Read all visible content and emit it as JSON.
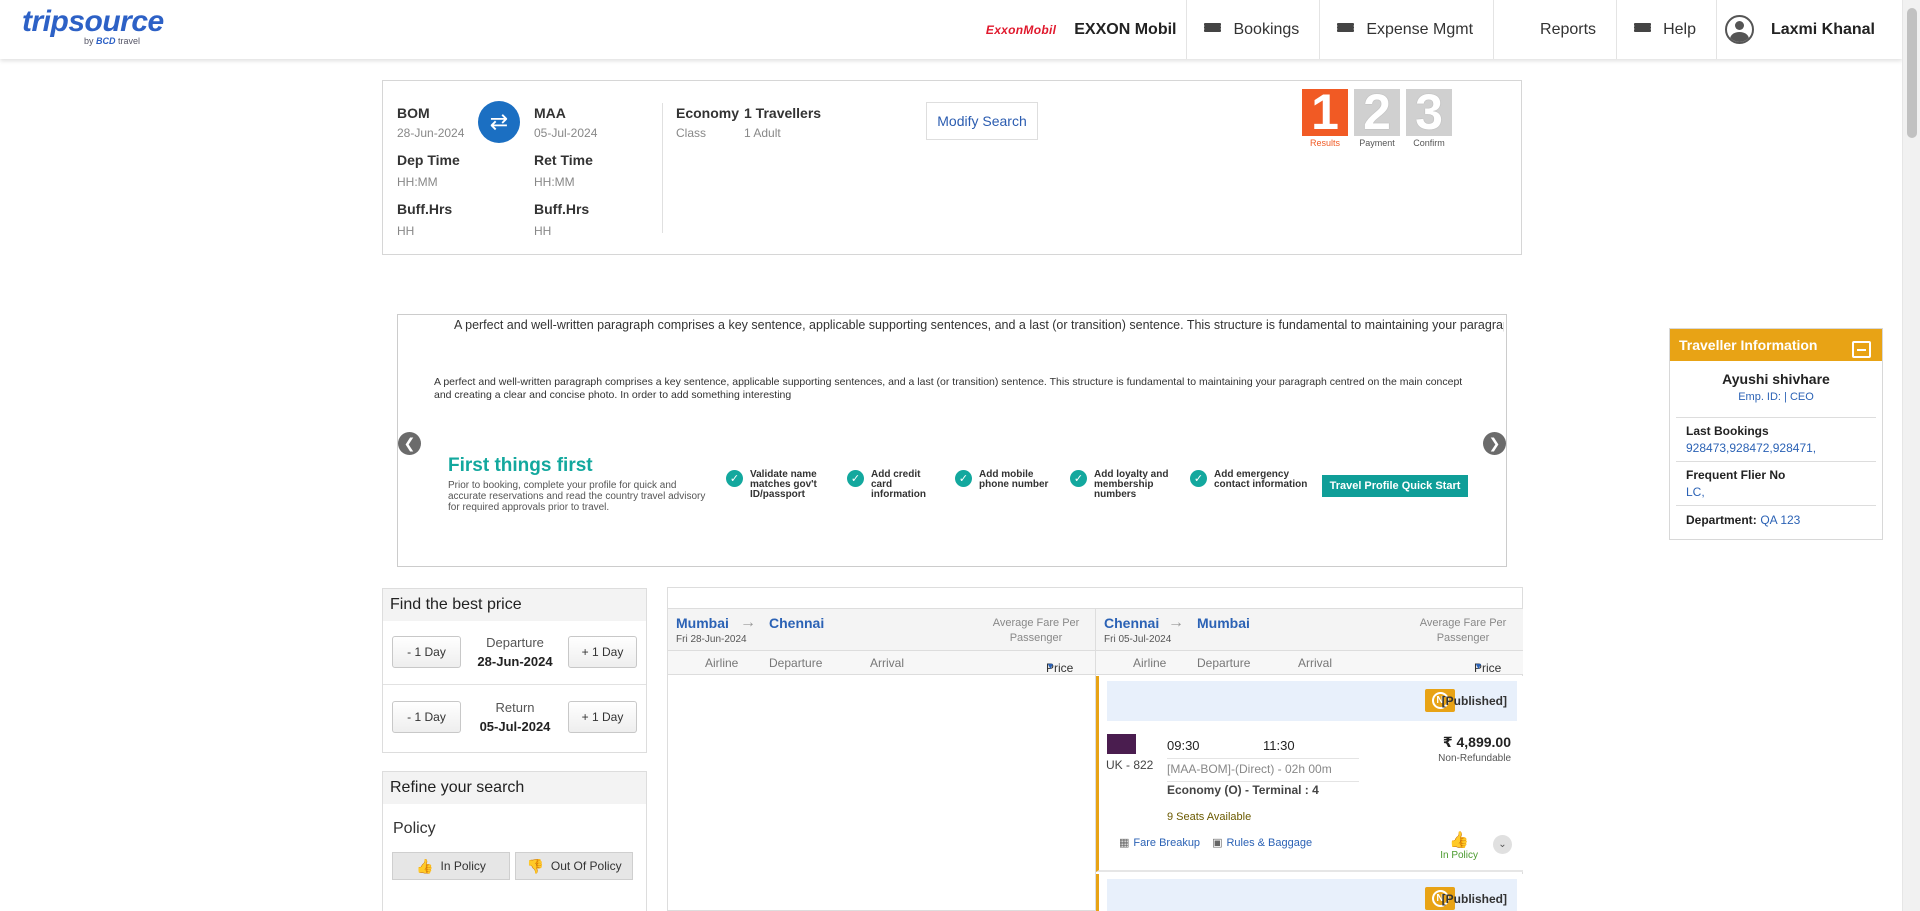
{
  "header": {
    "logo_main": "tripsource",
    "logo_sub_prefix": "by",
    "logo_sub_brand": "BCD",
    "logo_sub_suffix": "travel",
    "company_logo_text": "ExxonMobil",
    "company_name": "EXXON Mobil",
    "nav": [
      {
        "label": "Bookings",
        "icon": "menu-icon"
      },
      {
        "label": "Expense Mgmt",
        "icon": "menu-icon"
      },
      {
        "label": "Reports",
        "icon": "bar-chart-icon"
      },
      {
        "label": "Help",
        "icon": "menu-icon"
      }
    ],
    "user_name": "Laxmi Khanal"
  },
  "search_summary": {
    "origin": {
      "code": "BOM",
      "date": "28-Jun-2024",
      "time_label": "Dep Time",
      "time_hint": "HH:MM",
      "buffer_label": "Buff.Hrs",
      "buffer_hint": "HH"
    },
    "destination": {
      "code": "MAA",
      "date": "05-Jul-2024",
      "time_label": "Ret Time",
      "time_hint": "HH:MM",
      "buffer_label": "Buff.Hrs",
      "buffer_hint": "HH"
    },
    "cabin": {
      "value": "Economy",
      "label": "Class"
    },
    "travellers": {
      "value": "1 Travellers",
      "label": "1 Adult"
    },
    "modify_label": "Modify Search",
    "steps": [
      {
        "num": "1",
        "label": "Results",
        "active": true
      },
      {
        "num": "2",
        "label": "Payment",
        "active": false
      },
      {
        "num": "3",
        "label": "Confirm",
        "active": false
      }
    ]
  },
  "banner": {
    "line1": "A perfect and well-written paragraph comprises a key sentence, applicable supporting sentences, and a last (or transition) sentence. This structure is fundamental to maintaining your paragraph ce",
    "paragraph": "A perfect and well-written paragraph comprises a key sentence, applicable supporting sentences, and a last (or transition) sentence. This structure is fundamental to maintaining your paragraph centred on the main concept and creating a clear and concise photo. In order to add something interesting",
    "promo_title": "First things first",
    "promo_desc": "Prior to booking, complete your profile for quick and accurate reservations and read the country travel advisory for required approvals prior to travel.",
    "checklist": [
      "Validate name matches gov't ID/passport",
      "Add credit card information",
      "Add mobile phone number",
      "Add loyalty and membership numbers",
      "Add emergency contact information"
    ],
    "cta": "Travel Profile Quick Start"
  },
  "traveller": {
    "title": "Traveller Information",
    "name": "Ayushi shivhare",
    "emp": "Emp. ID: | CEO",
    "last_bookings_label": "Last Bookings",
    "last_bookings_value": "928473,928472,928471,",
    "ff_label": "Frequent Flier No",
    "ff_value": "LC,",
    "dept_label": "Department",
    "dept_value": "QA 123"
  },
  "best_price": {
    "title": "Find the best price",
    "minus_label": "- 1 Day",
    "plus_label": "+ 1 Day",
    "departure_label": "Departure",
    "departure_date": "28-Jun-2024",
    "return_label": "Return",
    "return_date": "05-Jul-2024"
  },
  "refine": {
    "title": "Refine your search",
    "policy_label": "Policy",
    "in_policy": "In Policy",
    "out_policy": "Out Of Policy"
  },
  "results": {
    "outbound": {
      "from": "Mumbai",
      "to": "Chennai",
      "date": "Fri 28-Jun-2024",
      "avg": "Average Fare Per Passenger"
    },
    "inbound": {
      "from": "Chennai",
      "to": "Mumbai",
      "date": "Fri 05-Jul-2024",
      "avg": "Average Fare Per Passenger"
    },
    "columns": {
      "airline": "Airline",
      "departure": "Departure",
      "arrival": "Arrival",
      "price": "Price"
    },
    "flights": [
      {
        "badge": "N",
        "fare_type": "[Published]",
        "flight_no": "UK - 822",
        "dep_time": "09:30",
        "arr_time": "11:30",
        "route": "[MAA-BOM]-(Direct) - 02h 00m",
        "cabin": "Economy (O) - Terminal : 4",
        "seats": "9 Seats Available",
        "price": "₹ 4,899.00",
        "refund": "Non-Refundable",
        "fare_breakup": "Fare Breakup",
        "rules": "Rules & Baggage",
        "policy": "In Policy"
      },
      {
        "badge": "N",
        "fare_type": "[Published]"
      }
    ]
  }
}
